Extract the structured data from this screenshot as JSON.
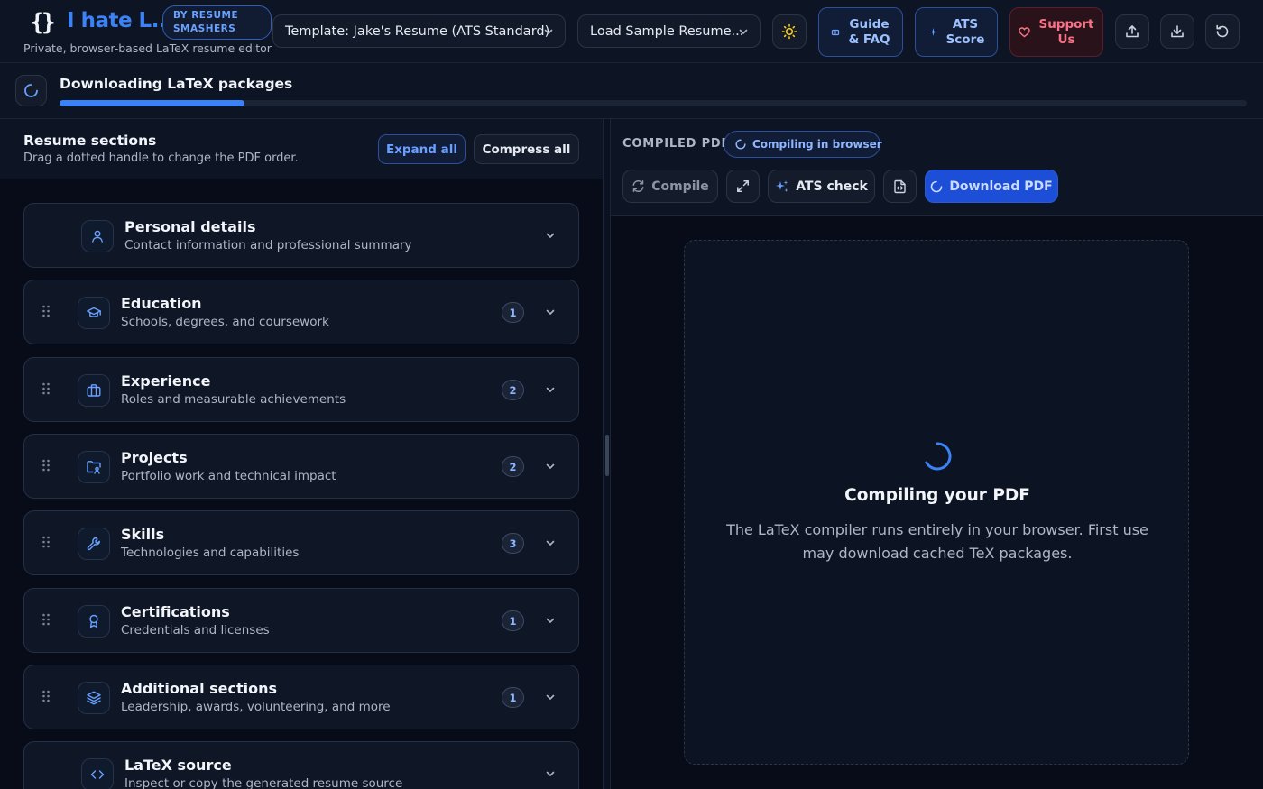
{
  "header": {
    "logo_glyph": "{}",
    "brand": "I hate L...",
    "badge_line1": "BY RESUME",
    "badge_line2": "SMASHERS",
    "tagline": "Private, browser-based LaTeX resume editor",
    "template_select": "Template: Jake's Resume (ATS Standard)",
    "sample_select": "Load Sample Resume...",
    "guide_line1": "Guide",
    "guide_line2": "& FAQ",
    "ats_line1": "ATS",
    "ats_line2": "Score",
    "support_line1": "Support",
    "support_line2": "Us"
  },
  "progress": {
    "title": "Downloading LaTeX packages",
    "percent": 15.6
  },
  "left": {
    "title": "Resume sections",
    "subtitle": "Drag a dotted handle to change the PDF order.",
    "expand_label": "Expand all",
    "compress_label": "Compress all",
    "sections": [
      {
        "title": "Personal details",
        "subtitle": "Contact information and professional summary",
        "count": "",
        "icon": "user-icon"
      },
      {
        "title": "Education",
        "subtitle": "Schools, degrees, and coursework",
        "count": "1",
        "icon": "graduation-cap-icon"
      },
      {
        "title": "Experience",
        "subtitle": "Roles and measurable achievements",
        "count": "2",
        "icon": "briefcase-icon"
      },
      {
        "title": "Projects",
        "subtitle": "Portfolio work and technical impact",
        "count": "2",
        "icon": "folder-user-icon"
      },
      {
        "title": "Skills",
        "subtitle": "Technologies and capabilities",
        "count": "3",
        "icon": "wrench-icon"
      },
      {
        "title": "Certifications",
        "subtitle": "Credentials and licenses",
        "count": "1",
        "icon": "award-icon"
      },
      {
        "title": "Additional sections",
        "subtitle": "Leadership, awards, volunteering, and more",
        "count": "1",
        "icon": "layers-icon"
      },
      {
        "title": "LaTeX source",
        "subtitle": "Inspect or copy the generated resume source",
        "count": "",
        "icon": "code-icon"
      }
    ]
  },
  "right": {
    "label": "COMPILED PDF",
    "status_badge": "Compiling in browser",
    "compile_label": "Compile",
    "ats_check_label": "ATS check",
    "download_label": "Download PDF",
    "compiling_title": "Compiling your PDF",
    "compiling_desc": "The LaTeX compiler runs entirely in your browser. First use may download cached TeX packages."
  },
  "colors": {
    "accent": "#3b82f6",
    "background": "#0b1120",
    "support": "#fb7185"
  }
}
